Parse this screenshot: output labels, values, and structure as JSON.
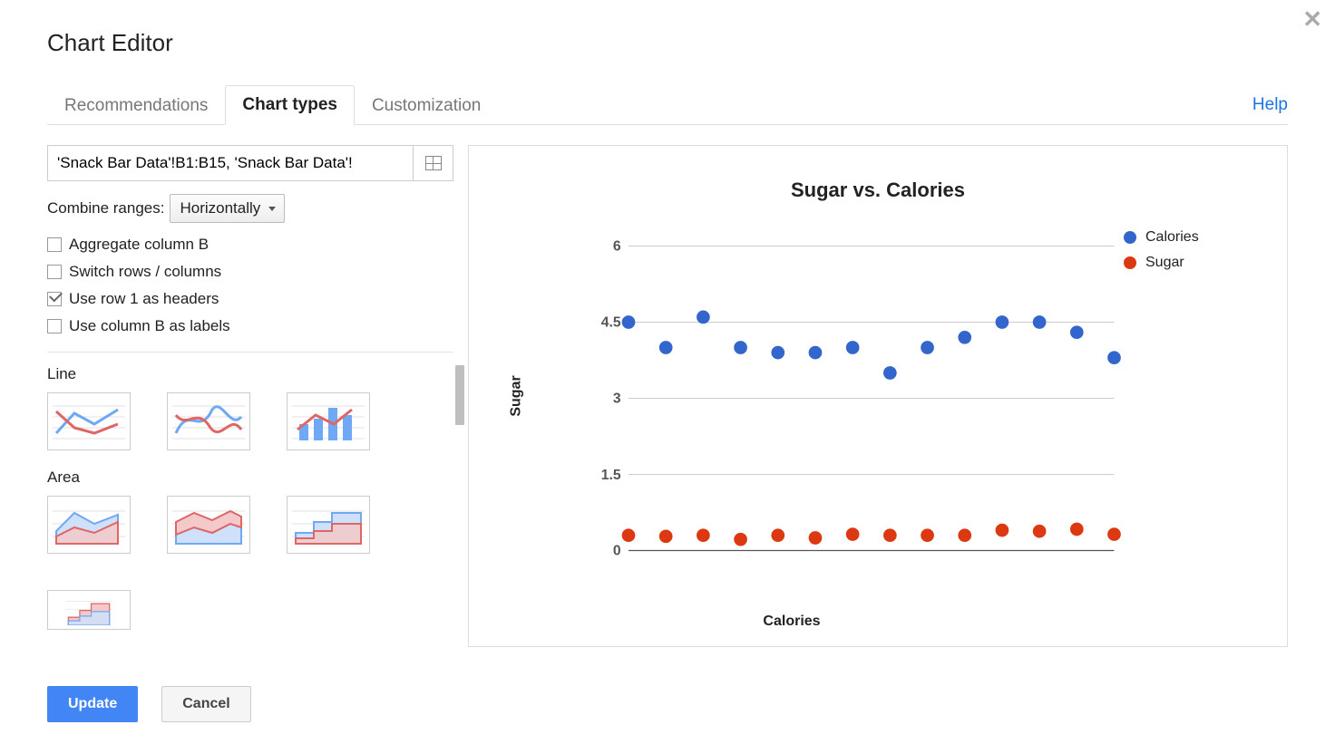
{
  "title": "Chart Editor",
  "tabs": {
    "recommendations": "Recommendations",
    "chart_types": "Chart types",
    "customization": "Customization",
    "active": "chart_types"
  },
  "help_label": "Help",
  "range": {
    "value": "'Snack Bar Data'!B1:B15, 'Snack Bar Data'!"
  },
  "combine": {
    "label": "Combine ranges:",
    "selected": "Horizontally"
  },
  "checks": {
    "aggregate": {
      "label": "Aggregate column B",
      "checked": false
    },
    "switch": {
      "label": "Switch rows / columns",
      "checked": false
    },
    "headers": {
      "label": "Use row 1 as headers",
      "checked": true
    },
    "labels": {
      "label": "Use column B as labels",
      "checked": false
    }
  },
  "categories": {
    "line": "Line",
    "area": "Area"
  },
  "buttons": {
    "update": "Update",
    "cancel": "Cancel"
  },
  "chart_data": {
    "type": "scatter",
    "title": "Sugar vs. Calories",
    "xlabel": "Calories",
    "ylabel": "Sugar",
    "ylim": [
      0,
      6
    ],
    "yticks": [
      0,
      1.5,
      3,
      4.5,
      6
    ],
    "x_index": [
      1,
      2,
      3,
      4,
      5,
      6,
      7,
      8,
      9,
      10,
      11,
      12,
      13,
      14
    ],
    "series": [
      {
        "name": "Calories",
        "color": "#3366cc",
        "values": [
          4.5,
          4.0,
          4.6,
          4.0,
          3.9,
          3.9,
          4.0,
          3.5,
          4.0,
          4.2,
          4.5,
          4.5,
          4.3,
          3.8
        ]
      },
      {
        "name": "Sugar",
        "color": "#dc3912",
        "values": [
          0.3,
          0.28,
          0.3,
          0.22,
          0.3,
          0.25,
          0.32,
          0.3,
          0.3,
          0.3,
          0.4,
          0.38,
          0.42,
          0.32
        ]
      }
    ]
  },
  "colors": {
    "blue": "#3366cc",
    "red": "#dc3912"
  }
}
